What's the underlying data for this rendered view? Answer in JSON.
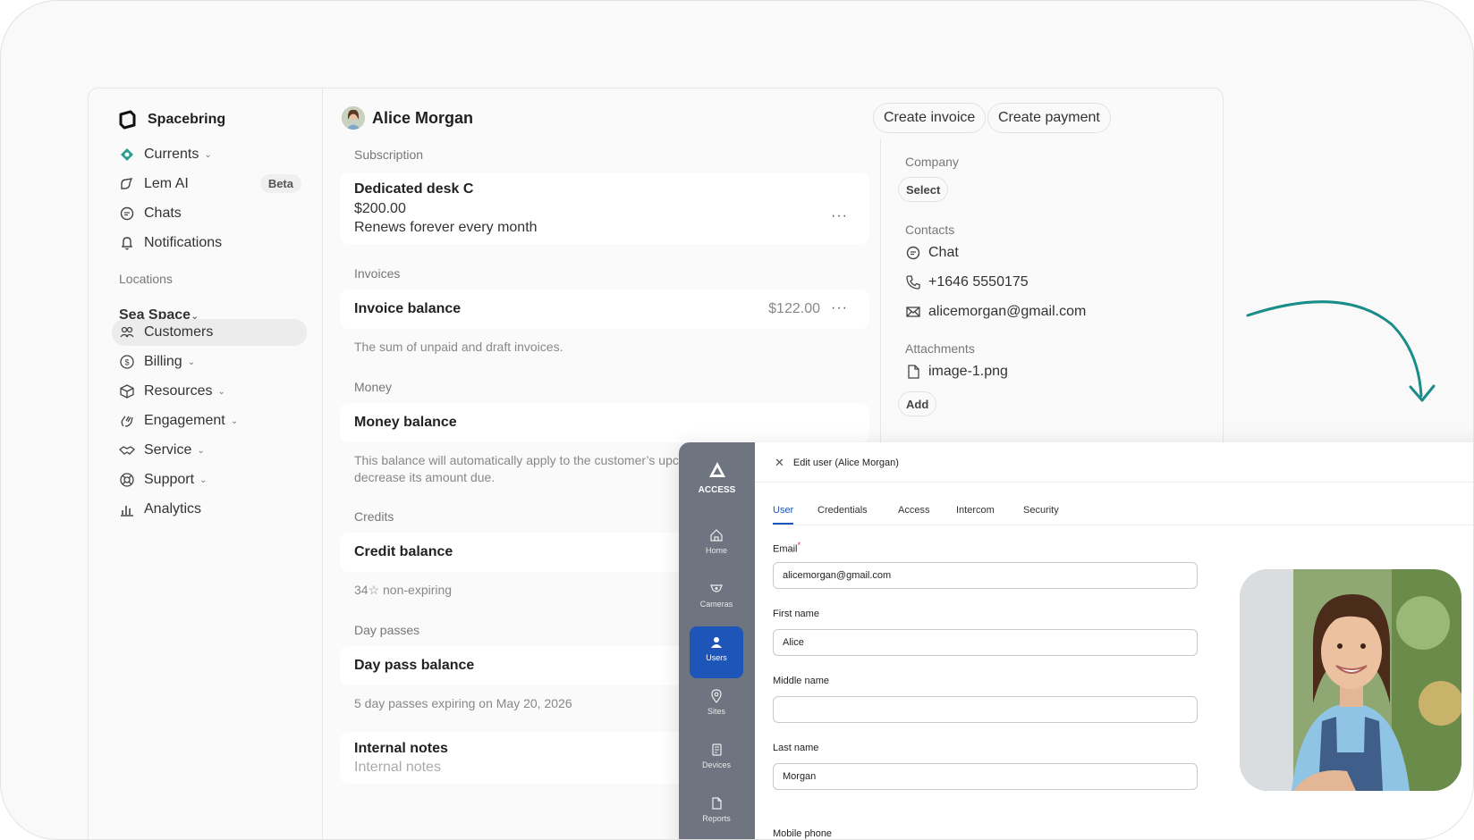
{
  "brand": {
    "name": "Spacebring"
  },
  "sidebar": {
    "items": [
      {
        "label": "Currents"
      },
      {
        "label": "Lem AI",
        "badge": "Beta"
      },
      {
        "label": "Chats"
      },
      {
        "label": "Notifications"
      }
    ],
    "locations_label": "Locations",
    "location": "Sea Space",
    "loc_items": [
      {
        "label": "Customers"
      },
      {
        "label": "Billing"
      },
      {
        "label": "Resources"
      },
      {
        "label": "Engagement"
      },
      {
        "label": "Service"
      },
      {
        "label": "Support"
      },
      {
        "label": "Analytics"
      }
    ]
  },
  "header": {
    "name": "Alice Morgan",
    "create_invoice": "Create invoice",
    "create_payment": "Create payment"
  },
  "subscription": {
    "label": "Subscription",
    "title": "Dedicated desk C",
    "price": "$200.00",
    "renew": "Renews forever every month"
  },
  "invoices": {
    "label": "Invoices",
    "title": "Invoice balance",
    "amount": "$122.00",
    "helper": "The sum of unpaid and draft invoices."
  },
  "money": {
    "label": "Money",
    "title": "Money balance",
    "helper1": "This balance will automatically apply to the customer’s upc",
    "helper2": "decrease its amount due."
  },
  "credits": {
    "label": "Credits",
    "title": "Credit balance",
    "helper": "34☆ non-expiring"
  },
  "day_passes": {
    "label": "Day passes",
    "title": "Day pass balance",
    "helper": "5 day passes expiring on May 20, 2026"
  },
  "notes": {
    "title": "Internal notes",
    "placeholder": "Internal notes"
  },
  "company": {
    "label": "Company",
    "select": "Select"
  },
  "contacts": {
    "label": "Contacts",
    "chat": "Chat",
    "phone": "+1646 5550175",
    "email": "alicemorgan@gmail.com"
  },
  "attachments": {
    "label": "Attachments",
    "file": "image-1.png",
    "add": "Add"
  },
  "access_app": {
    "brand": "ACCESS",
    "nav": [
      {
        "label": "Home"
      },
      {
        "label": "Cameras"
      },
      {
        "label": "Users"
      },
      {
        "label": "Sites"
      },
      {
        "label": "Devices"
      },
      {
        "label": "Reports"
      }
    ],
    "title": "Edit user (Alice Morgan)",
    "tabs": [
      "User",
      "Credentials",
      "Access",
      "Intercom",
      "Security"
    ],
    "fields": {
      "email_label": "Email",
      "email_value": "alicemorgan@gmail.com",
      "first_label": "First name",
      "first_value": "Alice",
      "middle_label": "Middle name",
      "middle_value": "",
      "last_label": "Last name",
      "last_value": "Morgan",
      "mobile_label": "Mobile phone"
    },
    "accent": "#1e55b8"
  },
  "colors": {
    "arrow": "#1a8c8a",
    "active_nav_bg": "#ececec"
  }
}
